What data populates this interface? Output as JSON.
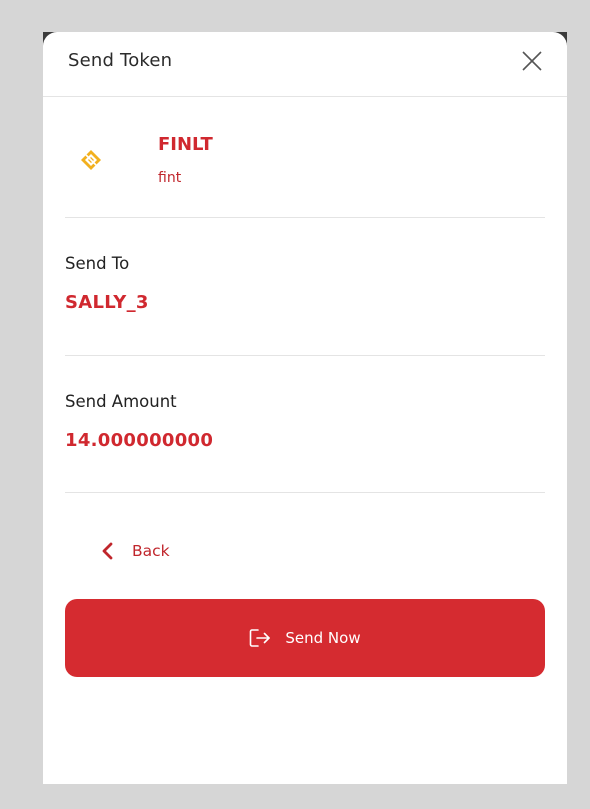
{
  "modal": {
    "title": "Send Token"
  },
  "token": {
    "symbol": "FINLT",
    "name": "fint",
    "icon": "diamond-logo-icon",
    "icon_color": "#f2b01e"
  },
  "send_to": {
    "label": "Send To",
    "value": "SALLY_3"
  },
  "send_amount": {
    "label": "Send Amount",
    "value": "14.000000000"
  },
  "actions": {
    "back_label": "Back",
    "send_label": "Send Now"
  },
  "colors": {
    "accent": "#d52b30",
    "background": "#d6d6d6"
  }
}
